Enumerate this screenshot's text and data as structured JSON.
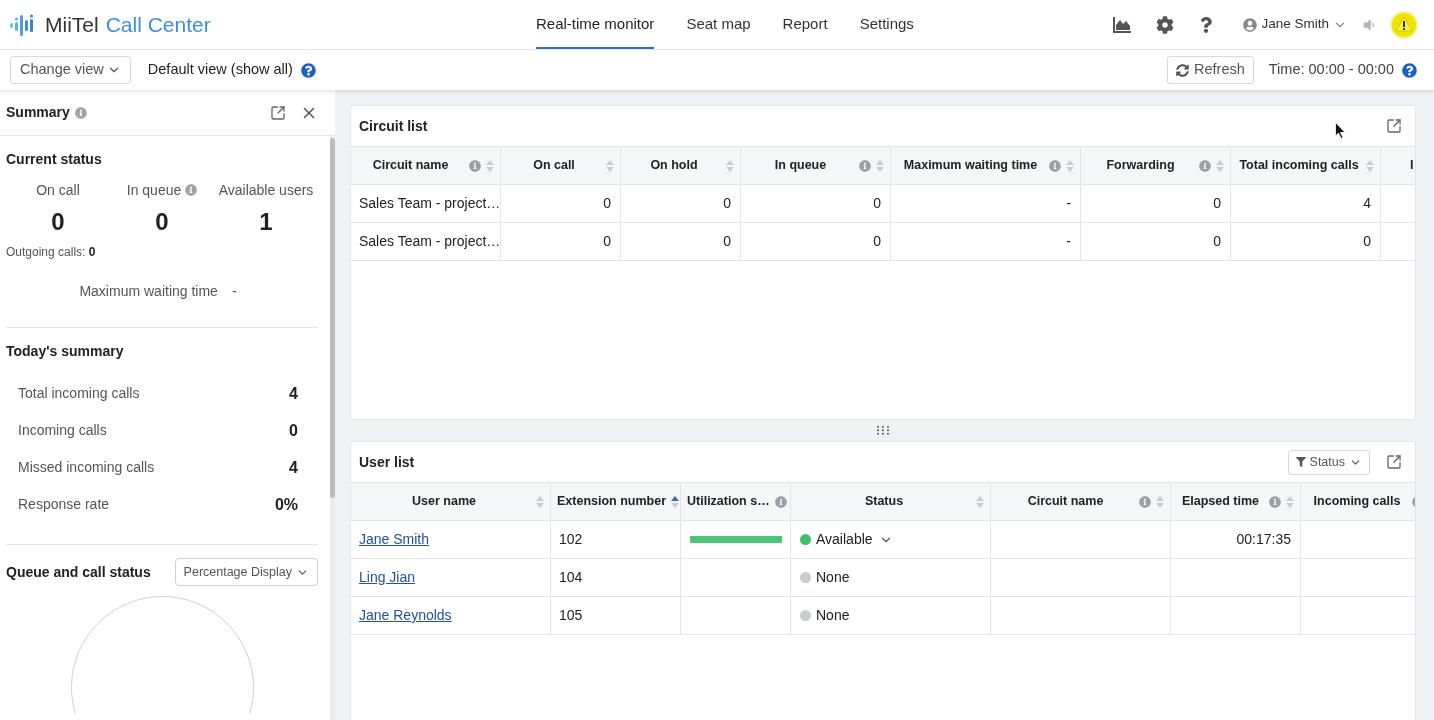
{
  "header": {
    "logo": {
      "brand": "MiiTel",
      "product": "Call Center"
    },
    "nav": [
      {
        "label": "Real-time monitor",
        "selected": true
      },
      {
        "label": "Seat map",
        "selected": false
      },
      {
        "label": "Report",
        "selected": false
      },
      {
        "label": "Settings",
        "selected": false
      }
    ],
    "user": {
      "name": "Jane Smith"
    }
  },
  "toolbar": {
    "change_view": "Change view",
    "view_name": "Default view (show all)",
    "refresh": "Refresh",
    "time": "Time: 00:00 - 00:00"
  },
  "summary": {
    "title": "Summary",
    "current_status": {
      "title": "Current status",
      "stats": [
        {
          "label": "On call",
          "value": "0",
          "info": false
        },
        {
          "label": "In queue",
          "value": "0",
          "info": true
        },
        {
          "label": "Available users",
          "value": "1",
          "info": false
        }
      ],
      "outgoing": "Outgoing calls: **0**",
      "max_wait": {
        "label": "Maximum waiting time",
        "value": "-"
      }
    },
    "today": {
      "title": "Today's summary",
      "rows": [
        {
          "label": "Total incoming calls",
          "value": "4"
        },
        {
          "label": "Incoming calls",
          "value": "0"
        },
        {
          "label": "Missed incoming calls",
          "value": "4"
        },
        {
          "label": "Response rate",
          "value": "0%"
        }
      ]
    },
    "queue_status": {
      "title": "Queue and call status",
      "display": "Percentage Display"
    }
  },
  "circuit_list": {
    "title": "Circuit list",
    "columns": [
      {
        "label": "Circuit name",
        "info": true,
        "sortable": true,
        "sorted": false
      },
      {
        "label": "On call",
        "info": false,
        "sortable": true,
        "sorted": false
      },
      {
        "label": "On hold",
        "info": false,
        "sortable": true,
        "sorted": false
      },
      {
        "label": "In queue",
        "info": true,
        "sortable": true,
        "sorted": false
      },
      {
        "label": "Maximum waiting time",
        "info": true,
        "sortable": true,
        "sorted": false
      },
      {
        "label": "Forwarding",
        "info": true,
        "sortable": true,
        "sorted": false
      },
      {
        "label": "Total incoming calls",
        "info": false,
        "sortable": true,
        "sorted": false
      },
      {
        "label": "I"
      }
    ],
    "rows": [
      [
        "Sales Team - project…",
        "0",
        "0",
        "0",
        "-",
        "0",
        "4"
      ],
      [
        "Sales Team - project…",
        "0",
        "0",
        "0",
        "-",
        "0",
        "0"
      ]
    ]
  },
  "user_list": {
    "title": "User list",
    "filter": "Status",
    "columns": [
      {
        "label": "User name",
        "info": false,
        "sortable": true,
        "sorted": false
      },
      {
        "label": "Extension number",
        "info": false,
        "sortable": true,
        "sorted": true
      },
      {
        "label": "Utilization s…",
        "info": true,
        "sortable": false
      },
      {
        "label": "Status",
        "info": false,
        "sortable": true,
        "sorted": false
      },
      {
        "label": "Circuit name",
        "info": true,
        "sortable": true,
        "sorted": false
      },
      {
        "label": "Elapsed time",
        "info": true,
        "sortable": true,
        "sorted": false
      },
      {
        "label": "Incoming calls",
        "info": true
      }
    ],
    "rows": [
      {
        "name": "Jane Smith",
        "extension": "102",
        "utilization_bar": true,
        "status": {
          "label": "Available",
          "color": "#3dbf6c",
          "dropdown": true
        },
        "elapsed": "00:17:35"
      },
      {
        "name": "Ling Jian",
        "extension": "104",
        "utilization_bar": false,
        "status": {
          "label": "None",
          "color": "#c9ccd1",
          "dropdown": false
        }
      },
      {
        "name": "Jane Reynolds",
        "extension": "105",
        "utilization_bar": false,
        "status": {
          "label": "None",
          "color": "#c9ccd1",
          "dropdown": false
        }
      }
    ]
  }
}
